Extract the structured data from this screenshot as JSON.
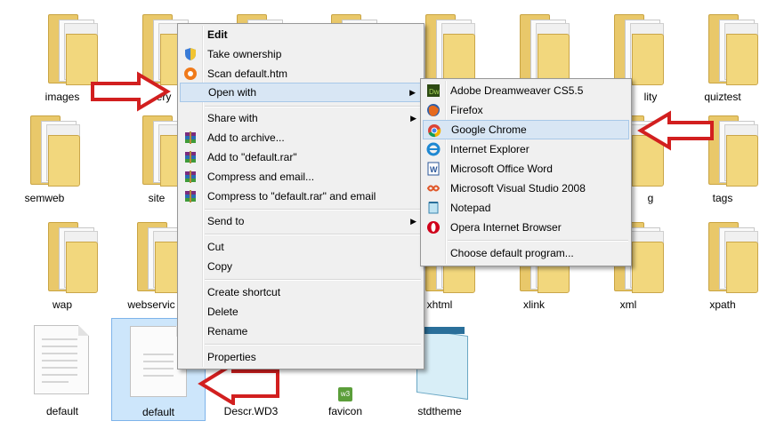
{
  "icons": [
    {
      "label": "images"
    },
    {
      "label": "jquery"
    },
    {
      "label": ""
    },
    {
      "label": ""
    },
    {
      "label": ""
    },
    {
      "label": ""
    },
    {
      "label": "lity"
    },
    {
      "label": "quiztest"
    },
    {
      "label": "semweb"
    },
    {
      "label": "site"
    },
    {
      "label": "g"
    },
    {
      "label": "tags"
    },
    {
      "label": "wap"
    },
    {
      "label": "webservic"
    },
    {
      "label": "xhtml"
    },
    {
      "label": "xlink"
    },
    {
      "label": "xml"
    },
    {
      "label": "xpath"
    },
    {
      "label": "default"
    },
    {
      "label": "default"
    },
    {
      "label": "Descr.WD3"
    },
    {
      "label": "favicon"
    },
    {
      "label": "stdtheme"
    }
  ],
  "context_menu": {
    "items": [
      {
        "label": "Edit",
        "icon": "none",
        "bold": true
      },
      {
        "label": "Take ownership",
        "icon": "shield-icon"
      },
      {
        "label": "Scan default.htm",
        "icon": "avast-icon"
      },
      {
        "label": "Open with",
        "icon": "none",
        "submenu": true
      },
      {
        "label": "Share with",
        "icon": "none",
        "submenu": true
      },
      {
        "label": "Add to archive...",
        "icon": "winrar-icon"
      },
      {
        "label": "Add to \"default.rar\"",
        "icon": "winrar-icon"
      },
      {
        "label": "Compress and email...",
        "icon": "winrar-icon"
      },
      {
        "label": "Compress to \"default.rar\" and email",
        "icon": "winrar-icon"
      },
      {
        "label": "Send to",
        "icon": "none",
        "submenu": true
      },
      {
        "label": "Cut",
        "icon": "none"
      },
      {
        "label": "Copy",
        "icon": "none"
      },
      {
        "label": "Create shortcut",
        "icon": "none"
      },
      {
        "label": "Delete",
        "icon": "none"
      },
      {
        "label": "Rename",
        "icon": "none"
      },
      {
        "label": "Properties",
        "icon": "none"
      }
    ]
  },
  "open_with_menu": {
    "items": [
      {
        "label": "Adobe Dreamweaver CS5.5",
        "icon": "dreamweaver-icon"
      },
      {
        "label": "Firefox",
        "icon": "firefox-icon"
      },
      {
        "label": "Google Chrome",
        "icon": "chrome-icon"
      },
      {
        "label": "Internet Explorer",
        "icon": "ie-icon"
      },
      {
        "label": "Microsoft Office Word",
        "icon": "word-icon"
      },
      {
        "label": "Microsoft Visual Studio 2008",
        "icon": "visual-studio-icon"
      },
      {
        "label": "Notepad",
        "icon": "notepad-icon"
      },
      {
        "label": "Opera Internet Browser",
        "icon": "opera-icon"
      },
      {
        "label": "Choose default program...",
        "icon": "none"
      }
    ]
  },
  "colors": {
    "highlight": "#d8e6f4",
    "arrow": "#d21f1f",
    "selection": "#cde6fb"
  }
}
